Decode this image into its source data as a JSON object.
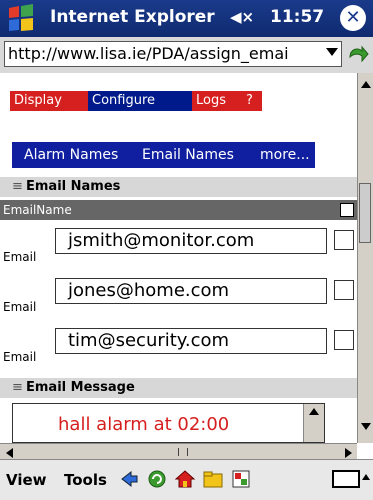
{
  "title_bar": {
    "app_title": "Internet Explorer",
    "volume_icon": "speaker-icon",
    "time": "11:57",
    "close_icon": "close-icon"
  },
  "address_bar": {
    "url": "http://www.lisa.ie/PDA/assign_emai",
    "go_icon": "go-arrow-icon"
  },
  "tabs": [
    {
      "label": "Display",
      "color": "#d61f1f"
    },
    {
      "label": "Configure",
      "color": "#001a8c"
    },
    {
      "label": "Logs",
      "color": "#d61f1f"
    },
    {
      "label": "?",
      "color": "#d61f1f"
    }
  ],
  "subnav": {
    "alarm_names": "Alarm Names",
    "email_names": "Email Names",
    "more": "more..."
  },
  "email_names_section": {
    "title": "Email Names",
    "column_header": "EmailName",
    "rows": [
      {
        "label": "Email",
        "value": "jsmith@monitor.com"
      },
      {
        "label": "Email",
        "value": "jones@home.com"
      },
      {
        "label": "Email",
        "value": "tim@security.com"
      }
    ]
  },
  "email_message_section": {
    "title": "Email Message",
    "message": "hall alarm at 02:00"
  },
  "toolbar": {
    "view": "View",
    "tools": "Tools"
  }
}
